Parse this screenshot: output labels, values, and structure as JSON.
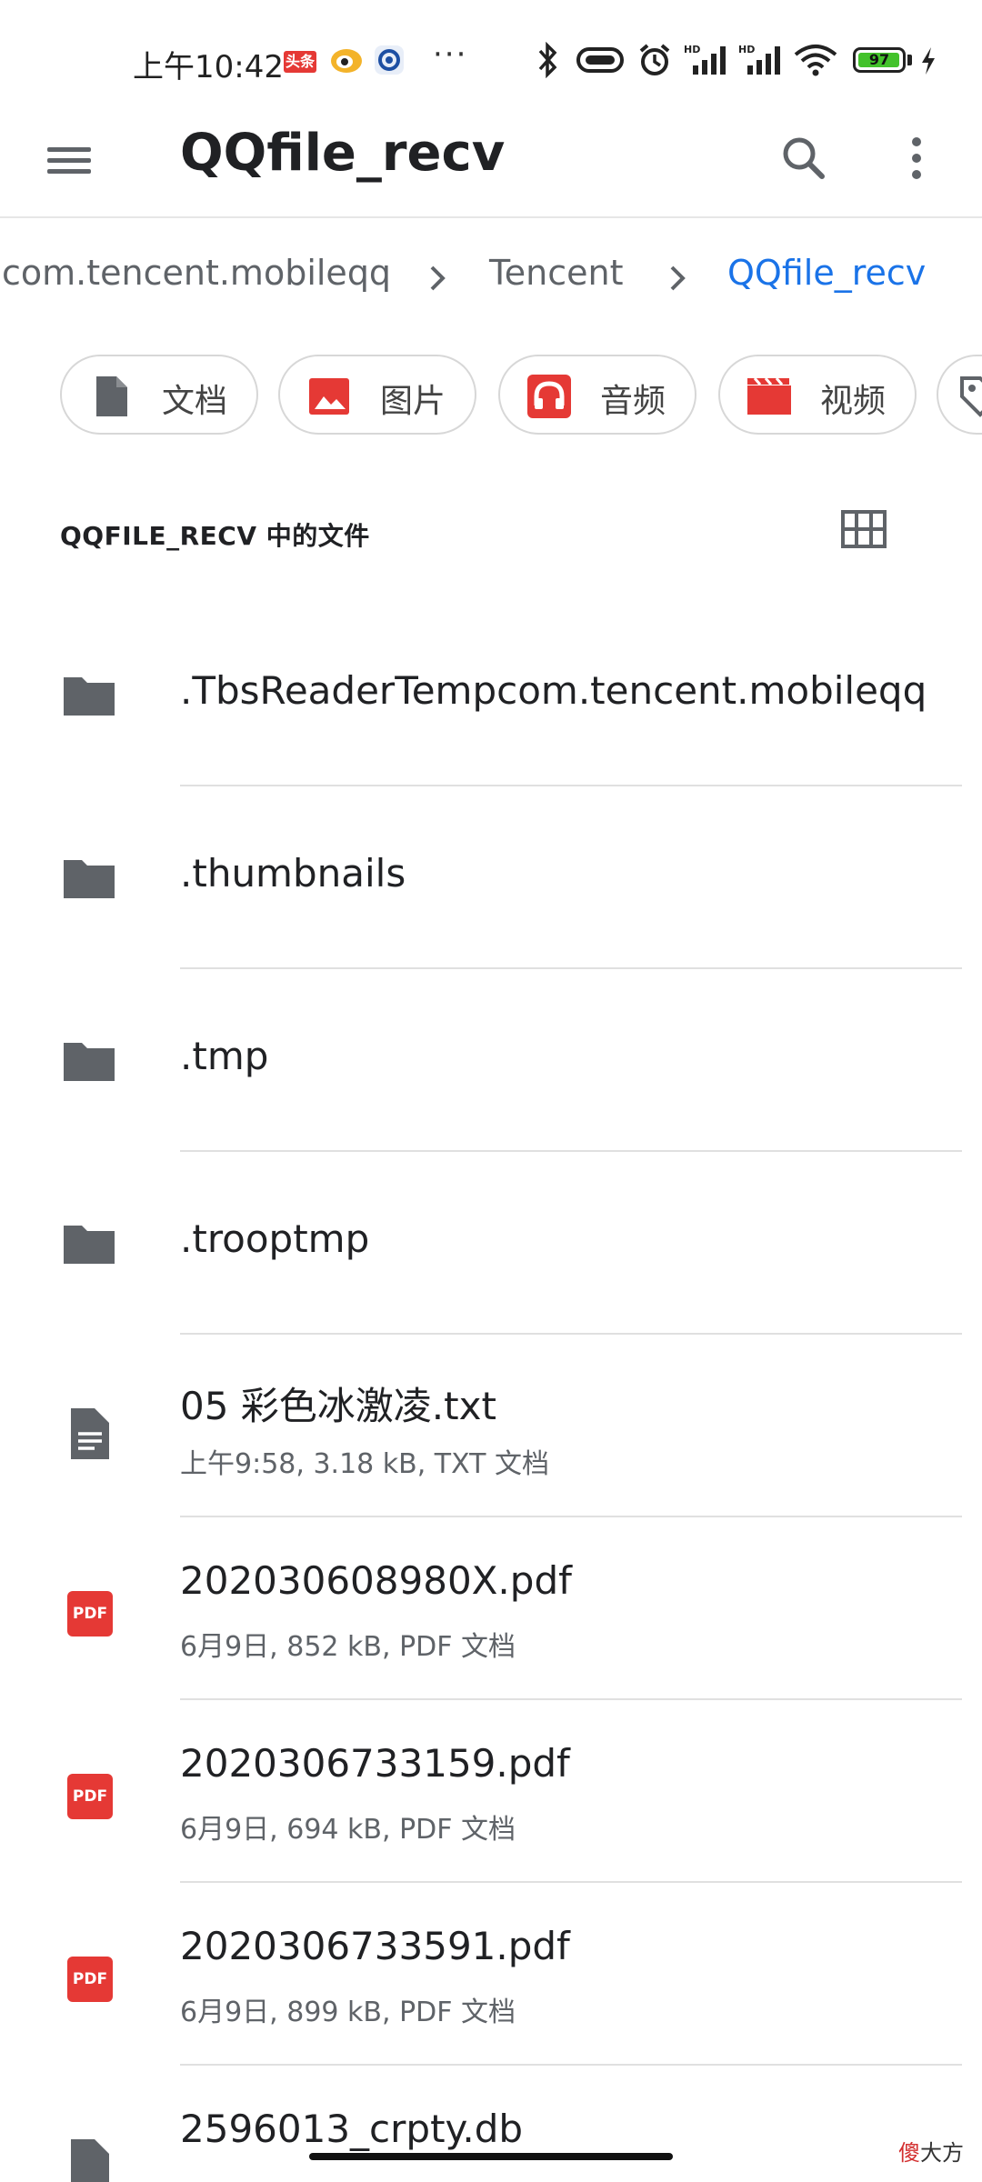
{
  "status_bar": {
    "time": "上午10:42",
    "toutiao_badge": "头条",
    "overflow": "···",
    "battery_level": "97",
    "battery_fraction": 0.97,
    "network_1": "HD",
    "network_2": "HD"
  },
  "app_bar": {
    "title": "QQfile_recv"
  },
  "breadcrumb": {
    "items": [
      "com.tencent.mobileqq",
      "Tencent",
      "QQfile_recv"
    ]
  },
  "chips": [
    {
      "label": "文档",
      "icon": "document-icon"
    },
    {
      "label": "图片",
      "icon": "image-icon"
    },
    {
      "label": "音频",
      "icon": "headphones-icon"
    },
    {
      "label": "视频",
      "icon": "video-icon"
    }
  ],
  "section": {
    "title": "QQFILE_RECV 中的文件"
  },
  "files": [
    {
      "name": ".TbsReaderTempcom.tencent.mobileqq",
      "type": "folder"
    },
    {
      "name": ".thumbnails",
      "type": "folder"
    },
    {
      "name": ".tmp",
      "type": "folder"
    },
    {
      "name": ".trooptmp",
      "type": "folder"
    },
    {
      "name": "05 彩色冰激凌.txt",
      "type": "text",
      "meta": "上午9:58, 3.18 kB, TXT 文档"
    },
    {
      "name": "202030608980X.pdf",
      "type": "pdf",
      "meta": "6月9日, 852 kB, PDF 文档",
      "badge": "PDF"
    },
    {
      "name": "2020306733159.pdf",
      "type": "pdf",
      "meta": "6月9日, 694 kB, PDF 文档",
      "badge": "PDF"
    },
    {
      "name": "2020306733591.pdf",
      "type": "pdf",
      "meta": "6月9日, 899 kB, PDF 文档",
      "badge": "PDF"
    },
    {
      "name": "2596013_crpty.db",
      "type": "file"
    }
  ],
  "watermark": {
    "red": "傻",
    "black": "大方"
  },
  "colors": {
    "accent": "#1a73e8",
    "icon_gray": "#5f6368",
    "pdf_red": "#e53935"
  }
}
